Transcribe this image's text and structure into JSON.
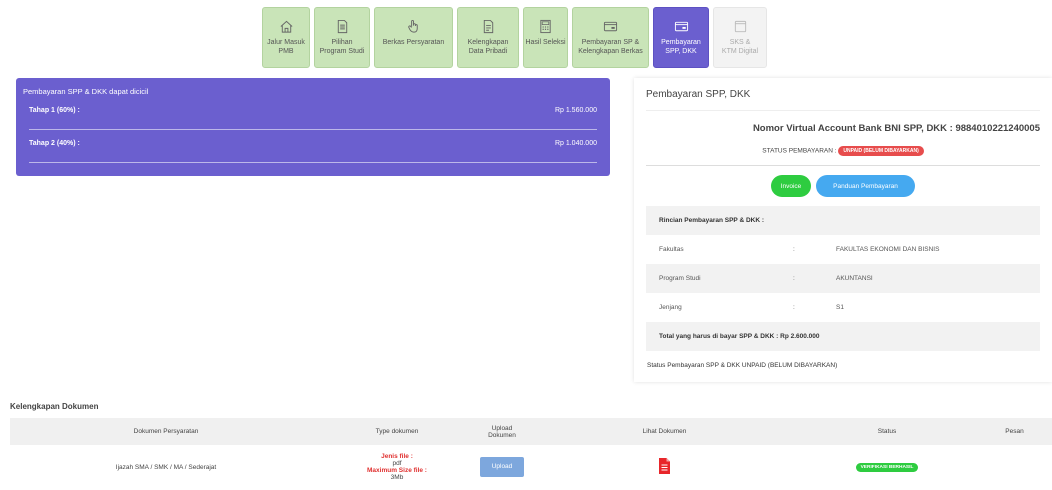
{
  "steps": [
    {
      "label": "Jalur Masuk\nPMB",
      "icon": "home-icon",
      "state": "done"
    },
    {
      "label": "Pilihan\nProgram Studi",
      "icon": "document-icon",
      "state": "done"
    },
    {
      "label": "Berkas Persyaratan",
      "icon": "hand-pointer-icon",
      "state": "done"
    },
    {
      "label": "Kelengkapan\nData Pribadi",
      "icon": "file-list-icon",
      "state": "done"
    },
    {
      "label": "Hasil Seleksi",
      "icon": "calculator-icon",
      "state": "done"
    },
    {
      "label": "Pembayaran SP &\nKelengkapan Berkas",
      "icon": "payment-card-icon",
      "state": "done"
    },
    {
      "label": "Pembayaran\nSPP, DKK",
      "icon": "payment-card-icon",
      "state": "active"
    },
    {
      "label": "SKS &\nKTM Digital",
      "icon": "id-card-icon",
      "state": "disabled"
    }
  ],
  "installments": {
    "header": "Pembayaran SPP & DKK dapat dicicil",
    "rows": [
      {
        "label": "Tahap 1 (60%) :",
        "amount": "Rp 1.560.000"
      },
      {
        "label": "Tahap 2 (40%) :",
        "amount": "Rp 1.040.000"
      }
    ]
  },
  "payment": {
    "title": "Pembayaran SPP, DKK",
    "va_text": "Nomor Virtual Account Bank BNI SPP, DKK : 9884010221240005",
    "status_label": "STATUS PEMBAYARAN :",
    "status_badge": "UNPAID (BELUM DIBAYARKAN)",
    "invoice_button": "Invoice",
    "guide_button": "Panduan Pembayaran",
    "detail_header": "Rincian Pembayaran SPP & DKK :",
    "details": [
      {
        "key": "Fakultas",
        "sep": ":",
        "value": "FAKULTAS EKONOMI DAN BISNIS"
      },
      {
        "key": "Program Studi",
        "sep": ":",
        "value": "AKUNTANSI"
      },
      {
        "key": "Jenjang",
        "sep": ":",
        "value": "S1"
      }
    ],
    "total": "Total yang harus di bayar SPP & DKK : Rp 2.600.000",
    "footer": "Status Pembayaran SPP & DKK UNPAID (BELUM DIBAYARKAN)"
  },
  "documents": {
    "title": "Kelengkapan Dokumen",
    "columns": [
      "Dokumen Persyaratan",
      "Type dokumen",
      "Upload\nDokumen",
      "Lihat Dokumen",
      "Status",
      "Pesan"
    ],
    "rows": [
      {
        "name": "Ijazah SMA / SMK / MA / Sederajat",
        "type_label1": "Jenis file :",
        "type_value1": "pdf",
        "type_label2": "Maximum Size file :",
        "type_value2": "3Mb",
        "upload_label": "Upload",
        "view_icon": "pdf-file-icon",
        "status": "VERIFIKASI BERHASIL",
        "message": ""
      }
    ]
  },
  "colors": {
    "active_step": "#6b5fcf",
    "done_step": "#c9e4b8",
    "unpaid_badge": "#e74c4c",
    "verified_badge": "#2ecc40",
    "invoice_button": "#2ecc40",
    "guide_button": "#45a9f0"
  }
}
